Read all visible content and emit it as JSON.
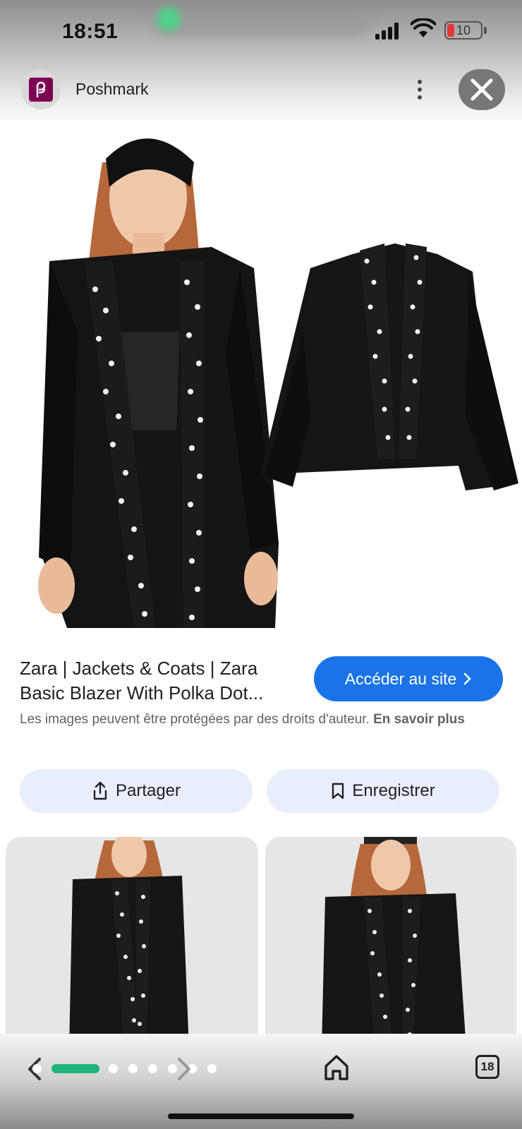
{
  "status_bar": {
    "time": "18:51",
    "battery_level": "10",
    "battery_color": "#e53935"
  },
  "source": {
    "site_name": "Poshmark",
    "brand_color": "#7f0353"
  },
  "result": {
    "title": "Zara | Jackets & Coats | Zara Basic Blazer With Polka Dot...",
    "visit_label": "Accéder au site",
    "copyright_text": "Les images peuvent être protégées par des droits d'auteur.",
    "learn_more_label": "En savoir plus",
    "accent_color": "#1a73e8"
  },
  "actions": {
    "share_label": "Partager",
    "save_label": "Enregistrer"
  },
  "bottom_bar": {
    "tab_count": "18",
    "pager_active_color": "#1fb37a"
  }
}
